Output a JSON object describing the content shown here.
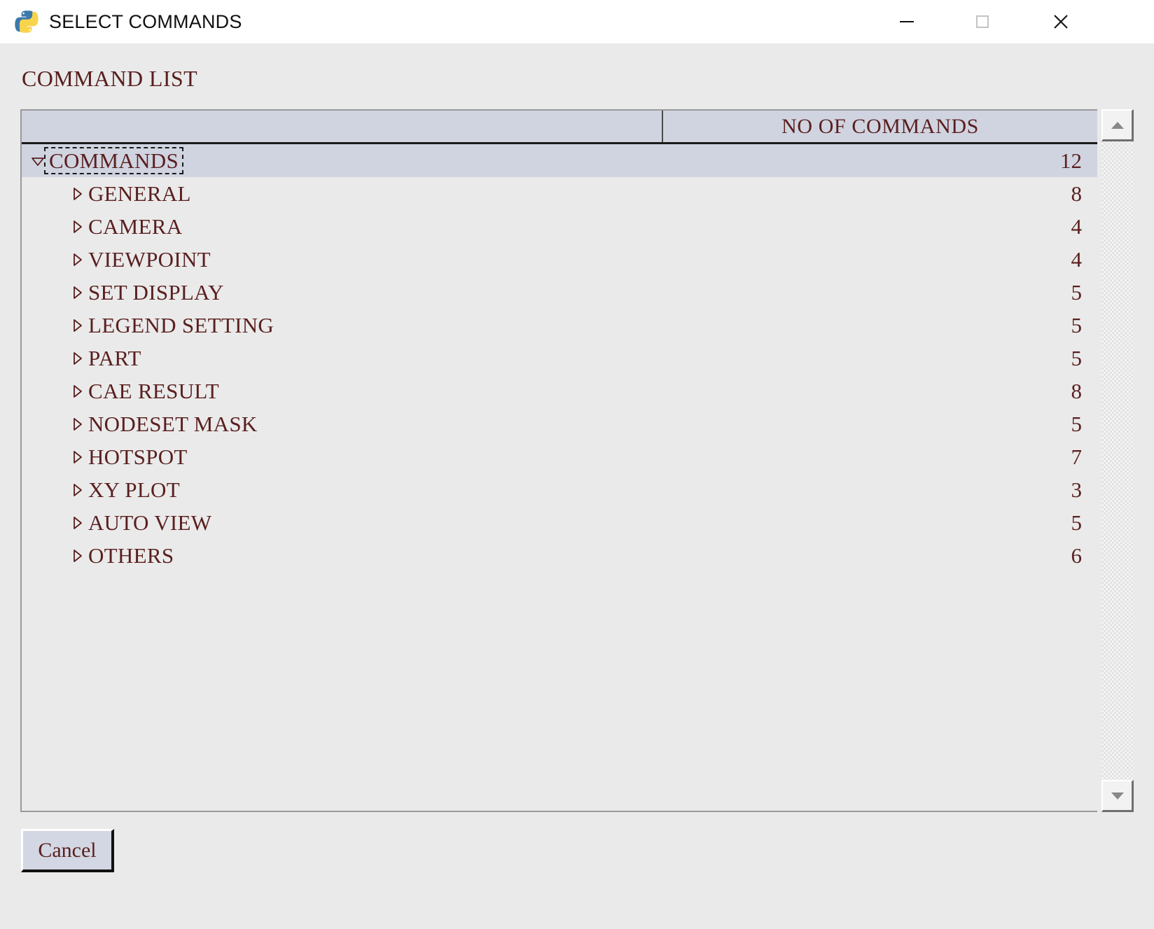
{
  "window": {
    "title": "SELECT COMMANDS",
    "app_icon": "python-logo-icon",
    "controls": {
      "minimize": "minimize-icon",
      "maximize": "maximize-icon",
      "close": "close-icon"
    }
  },
  "section": {
    "title": "COMMAND LIST"
  },
  "tree": {
    "columns": [
      {
        "label": ""
      },
      {
        "label": "NO OF COMMANDS"
      }
    ],
    "root": {
      "label": "COMMANDS",
      "count": "12",
      "expanded": true,
      "selected": true,
      "twisty": "triangle-down-icon"
    },
    "children": [
      {
        "label": "GENERAL",
        "count": "8",
        "expanded": false,
        "twisty": "triangle-right-icon"
      },
      {
        "label": "CAMERA",
        "count": "4",
        "expanded": false,
        "twisty": "triangle-right-icon"
      },
      {
        "label": "VIEWPOINT",
        "count": "4",
        "expanded": false,
        "twisty": "triangle-right-icon"
      },
      {
        "label": "SET DISPLAY",
        "count": "5",
        "expanded": false,
        "twisty": "triangle-right-icon"
      },
      {
        "label": "LEGEND SETTING",
        "count": "5",
        "expanded": false,
        "twisty": "triangle-right-icon"
      },
      {
        "label": "PART",
        "count": "5",
        "expanded": false,
        "twisty": "triangle-right-icon"
      },
      {
        "label": "CAE RESULT",
        "count": "8",
        "expanded": false,
        "twisty": "triangle-right-icon"
      },
      {
        "label": "NODESET MASK",
        "count": "5",
        "expanded": false,
        "twisty": "triangle-right-icon"
      },
      {
        "label": "HOTSPOT",
        "count": "7",
        "expanded": false,
        "twisty": "triangle-right-icon"
      },
      {
        "label": "XY PLOT",
        "count": "3",
        "expanded": false,
        "twisty": "triangle-right-icon"
      },
      {
        "label": "AUTO VIEW",
        "count": "5",
        "expanded": false,
        "twisty": "triangle-right-icon"
      },
      {
        "label": "OTHERS",
        "count": "6",
        "expanded": false,
        "twisty": "triangle-right-icon"
      }
    ]
  },
  "scrollbar": {
    "up": "scroll-up-arrow-icon",
    "down": "scroll-down-arrow-icon"
  },
  "buttons": {
    "cancel": "Cancel"
  },
  "colors": {
    "text_accent": "#5a1f1f",
    "panel_bg": "#eaeaea",
    "header_bg": "#d0d4e0",
    "selection_bg": "#d0d4e0",
    "titlebar_bg": "#ffffff"
  }
}
